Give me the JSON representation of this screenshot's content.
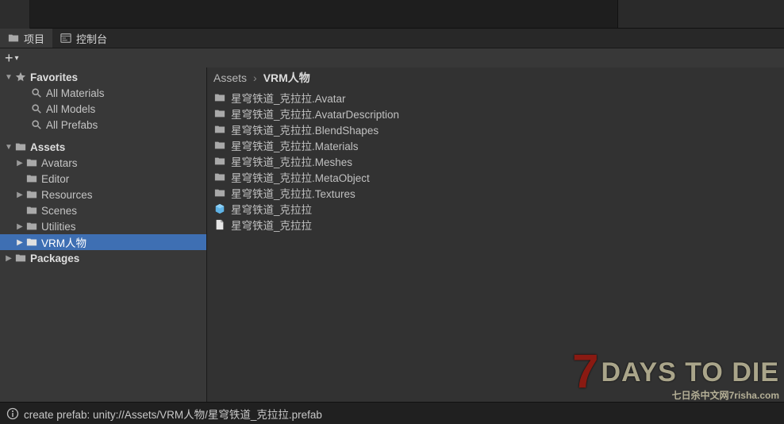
{
  "tabs": {
    "project": "项目",
    "console": "控制台"
  },
  "sidebar": {
    "favorites": {
      "label": "Favorites",
      "items": [
        "All Materials",
        "All Models",
        "All Prefabs"
      ]
    },
    "assets": {
      "label": "Assets",
      "items": [
        "Avatars",
        "Editor",
        "Resources",
        "Scenes",
        "Utilities",
        "VRM人物"
      ]
    },
    "packages": {
      "label": "Packages"
    }
  },
  "breadcrumb": {
    "root": "Assets",
    "current": "VRM人物"
  },
  "files": [
    {
      "name": "星穹铁道_克拉拉.Avatar",
      "type": "folder"
    },
    {
      "name": "星穹铁道_克拉拉.AvatarDescription",
      "type": "folder"
    },
    {
      "name": "星穹铁道_克拉拉.BlendShapes",
      "type": "folder"
    },
    {
      "name": "星穹铁道_克拉拉.Materials",
      "type": "folder"
    },
    {
      "name": "星穹铁道_克拉拉.Meshes",
      "type": "folder"
    },
    {
      "name": "星穹铁道_克拉拉.MetaObject",
      "type": "folder"
    },
    {
      "name": "星穹铁道_克拉拉.Textures",
      "type": "folder"
    },
    {
      "name": "星穹铁道_克拉拉",
      "type": "prefab"
    },
    {
      "name": "星穹铁道_克拉拉",
      "type": "file"
    }
  ],
  "status": {
    "message": "create prefab: unity://Assets/VRM人物/星穹铁道_克拉拉.prefab"
  },
  "watermark": {
    "big": "DAYS TO DIE",
    "sub": "七日杀中文网7risha.com"
  }
}
